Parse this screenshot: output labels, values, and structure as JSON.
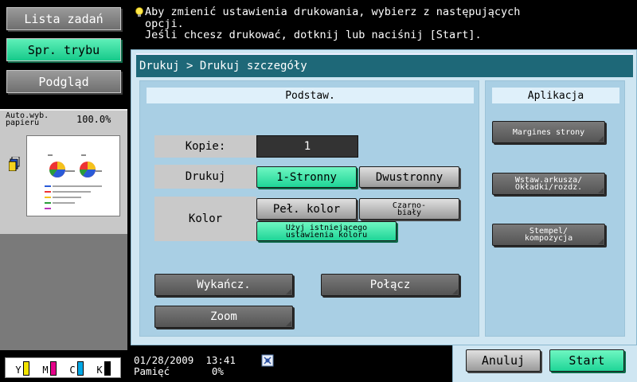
{
  "left_panel": {
    "job_list_label": "Lista zadań",
    "mode_check_label": "Spr. trybu",
    "preview_label": "Podgląd",
    "paper_label": "Auto.wyb. papieru",
    "zoom_value": "100.0%",
    "toner": [
      {
        "letter": "Y",
        "color": "#f2e300",
        "level": 1.0
      },
      {
        "letter": "M",
        "color": "#e5008a",
        "level": 1.0
      },
      {
        "letter": "C",
        "color": "#00a8e6",
        "level": 1.0
      },
      {
        "letter": "K",
        "color": "#000000",
        "level": 1.0
      }
    ]
  },
  "message": {
    "line1": "Aby zmienić ustawienia drukowania, wybierz z następujących",
    "line2": "opcji.",
    "line3": "Jeśli chcesz drukować, dotknij lub naciśnij [Start]."
  },
  "breadcrumb": "Drukuj > Drukuj szczegóły",
  "basic": {
    "header": "Podstaw.",
    "copies_label": "Kopie:",
    "copies_value": "1",
    "print_label": "Drukuj",
    "print_options": [
      "1-Stronny",
      "Dwustronny"
    ],
    "print_selected": "1-Stronny",
    "color_label": "Kolor",
    "color_options": [
      "Peł. kolor",
      "Czarno-\nbiały"
    ],
    "color_existing": "Użyj istniejącego\nustawienia koloru",
    "finishing_label": "Wykańcz.",
    "combine_label": "Połącz",
    "zoom_label": "Zoom"
  },
  "apps": {
    "header": "Aplikacja",
    "page_margin": "Margines strony",
    "insert_sheet": "Wstaw.arkusza/\nOkładki/rozdz.",
    "stamp": "Stempel/\nkompozycja"
  },
  "status": {
    "date": "01/28/2009",
    "time": "13:41",
    "memory_label": "Pamięć",
    "memory_value": "0%"
  },
  "actions": {
    "cancel": "Anuluj",
    "start": "Start"
  },
  "colors": {
    "accent_green": "#1fd597",
    "breadcrumb_bg": "#1e6878",
    "panel_bg": "#cfe6f2"
  }
}
